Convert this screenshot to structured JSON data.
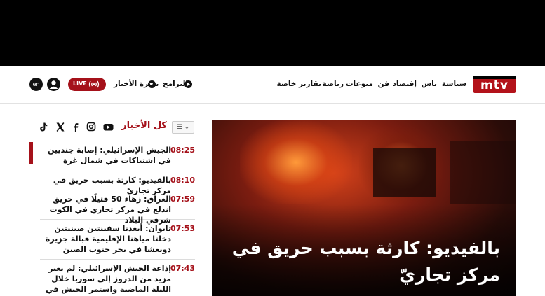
{
  "header": {
    "logo_text": "mtv",
    "nav": [
      "سياسة",
      "ناس",
      "إقتصاد",
      "فن",
      "منوعات",
      "رياضة",
      "تقارير خاصة"
    ],
    "programs_label": "البرامج",
    "news_bulletin_label": "نشرة الأخبار",
    "live_label": "LIVE",
    "lang_label": "en"
  },
  "sidebar": {
    "all_news_label": "كل الأخبار",
    "filter_label": "☰ ⌄",
    "social_icons": [
      "youtube-icon",
      "instagram-icon",
      "facebook-icon",
      "x-icon",
      "tiktok-icon"
    ],
    "news": [
      {
        "time": "08:25",
        "title": "الجيش الإسرائيلي: إصابة جنديين في اشتباكات في شمال غزة"
      },
      {
        "time": "08:10",
        "title": "بالفيديو: كارثة بسبب حريق في مركز تجاريّ"
      },
      {
        "time": "07:59",
        "title": "العراق: زهاء 50 قتيلًا في حريق اندلع في مركز تجاري في الكوت شرقي البلاد"
      },
      {
        "time": "07:53",
        "title": "تايوان: أبعدنا سفينتين صينيتين دخلتا مياهنا الإقليمية قبالة جزيرة دونغشا في بحر جنوب الصين"
      },
      {
        "time": "07:43",
        "title": "إذاعة الجيش الإسرائيلي: لم يعبر مزيد من الدروز إلى سوريا خلال الليلة الماضية واستمر الجيش في إخراج بعضهم وهناك عدد غير"
      }
    ]
  },
  "hero": {
    "title": "بالفيديو: كارثة بسبب حريق في مركز تجاريّ"
  },
  "colors": {
    "brand": "#a5111a",
    "topband": "#000000"
  }
}
